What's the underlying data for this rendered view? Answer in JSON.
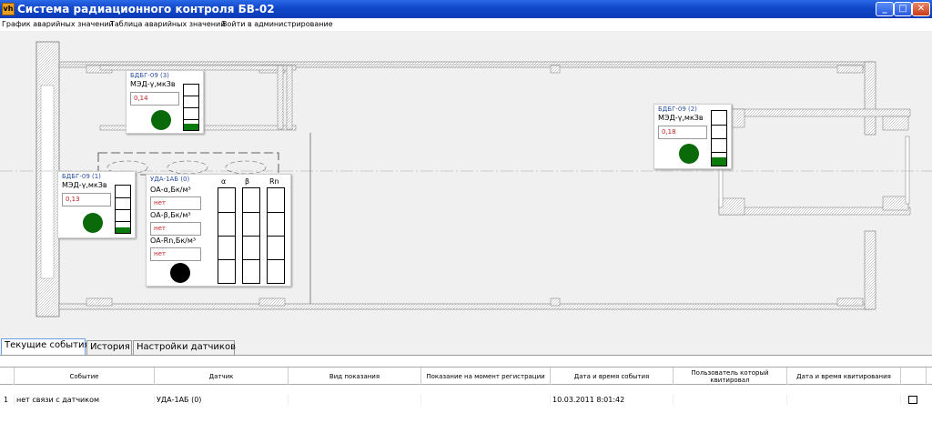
{
  "window": {
    "title": "Система радиационного контроля БВ-02",
    "icon": "app-icon",
    "app_icon_text": "vh"
  },
  "menu": [
    "График аварийных значений",
    "Таблица аварийных значений",
    "Войти в администрирование"
  ],
  "sensors": {
    "bdbg3": {
      "title": "БДБГ-09 (3)",
      "label": "МЭД-γ,мкЗв",
      "value": "0,14",
      "status_color": "#0a6a0a",
      "gauge_level": 0.15
    },
    "bdbg1": {
      "title": "БДБГ-09 (1)",
      "label": "МЭД-γ,мкЗв",
      "value": "0,13",
      "status_color": "#0a6a0a",
      "gauge_level": 0.12
    },
    "bdbg2": {
      "title": "БДБГ-09 (2)",
      "label": "МЭД-γ,мкЗв",
      "value": "0,18",
      "status_color": "#0a6a0a",
      "gauge_level": 0.15
    },
    "uda": {
      "title": "УДА-1АБ (0)",
      "labels": [
        "ОА-α,Бк/м³",
        "ОА-β,Бк/м³",
        "ОА-Rn,Бк/м³"
      ],
      "values": [
        "нет",
        "нет",
        "нет"
      ],
      "gauge_heads": [
        "α",
        "β",
        "Rn"
      ],
      "status_color": "#000000"
    }
  },
  "tabs": [
    "Текущие события",
    "История",
    "Настройки датчиков"
  ],
  "active_tab": 0,
  "table": {
    "columns": [
      "Событие",
      "Датчик",
      "Вид показания",
      "Показание на момент регистрации",
      "Дата и время события",
      "Пользователь который квитировал",
      "Дата и время квитирования"
    ],
    "rows": [
      {
        "num": "1",
        "event": "нет связи с датчиком",
        "sensor": "УДА-1АБ (0)",
        "kind": "",
        "reading": "",
        "datetime": "10.03.2011 8:01:42",
        "user": "",
        "ack_time": "",
        "checked": false
      }
    ]
  }
}
